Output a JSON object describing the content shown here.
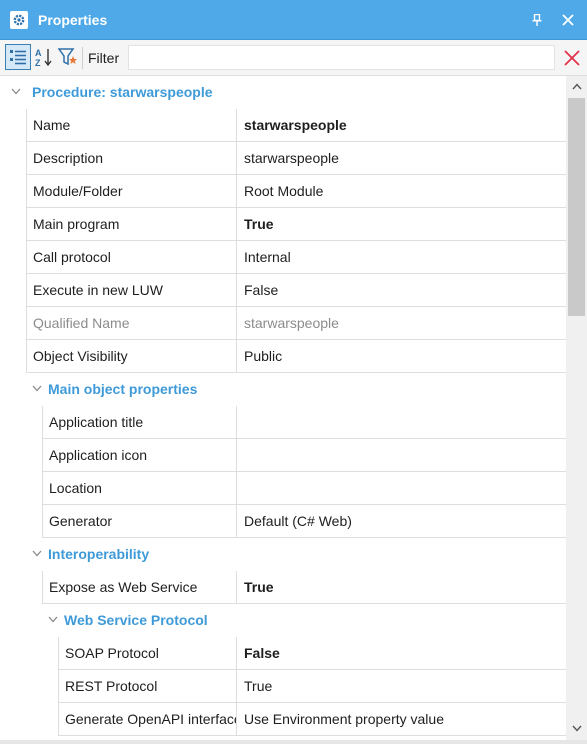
{
  "window": {
    "title": "Properties",
    "accent": "#4fa9e8",
    "category_color": "#3e9ad8"
  },
  "toolbar": {
    "categorized_icon": "categorized-view-icon",
    "alphabetical_icon": "sort-alphabetical-icon",
    "filter_icon": "filter-funnel-icon",
    "filter_label": "Filter",
    "filter_value": "",
    "clear_icon": "clear-x-icon"
  },
  "procedure": {
    "label": "Procedure: starwarspeople",
    "rows": [
      {
        "name": "Name",
        "value": "starwarspeople",
        "bold": true
      },
      {
        "name": "Description",
        "value": "starwarspeople"
      },
      {
        "name": "Module/Folder",
        "value": "Root Module"
      },
      {
        "name": "Main program",
        "value": "True",
        "bold": true
      },
      {
        "name": "Call protocol",
        "value": "Internal"
      },
      {
        "name": "Execute in new LUW",
        "value": "False"
      },
      {
        "name": "Qualified Name",
        "value": "starwarspeople",
        "disabled": true
      },
      {
        "name": "Object Visibility",
        "value": "Public"
      }
    ]
  },
  "main_object": {
    "label": "Main object properties",
    "rows": [
      {
        "name": "Application title",
        "value": ""
      },
      {
        "name": "Application icon",
        "value": ""
      },
      {
        "name": "Location",
        "value": ""
      },
      {
        "name": "Generator",
        "value": "Default (C# Web)"
      }
    ]
  },
  "interoperability": {
    "label": "Interoperability",
    "rows": [
      {
        "name": "Expose as Web Service",
        "value": "True",
        "bold": true
      }
    ]
  },
  "web_service": {
    "label": "Web Service Protocol",
    "rows": [
      {
        "name": "SOAP Protocol",
        "value": "False",
        "bold": true
      },
      {
        "name": "REST Protocol",
        "value": "True"
      },
      {
        "name": "Generate OpenAPI interface",
        "value": "Use Environment property value"
      }
    ]
  }
}
